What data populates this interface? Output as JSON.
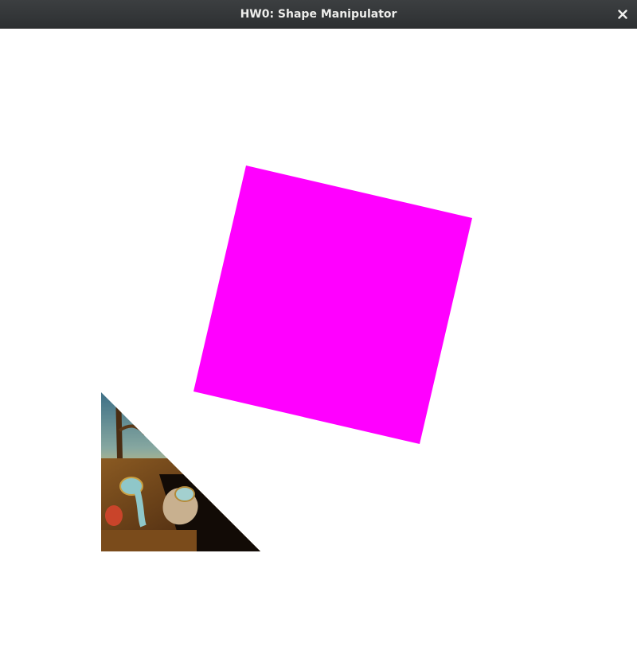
{
  "window": {
    "title": "HW0: Shape Manipulator",
    "close_icon": "close-icon"
  },
  "scene": {
    "background_color": "#ffffff",
    "square": {
      "fill_color": "#ff00ff"
    },
    "textured_triangle": {
      "texture": "The Persistence of Memory (Dalí) painting texture",
      "icon": "painting-texture"
    }
  }
}
